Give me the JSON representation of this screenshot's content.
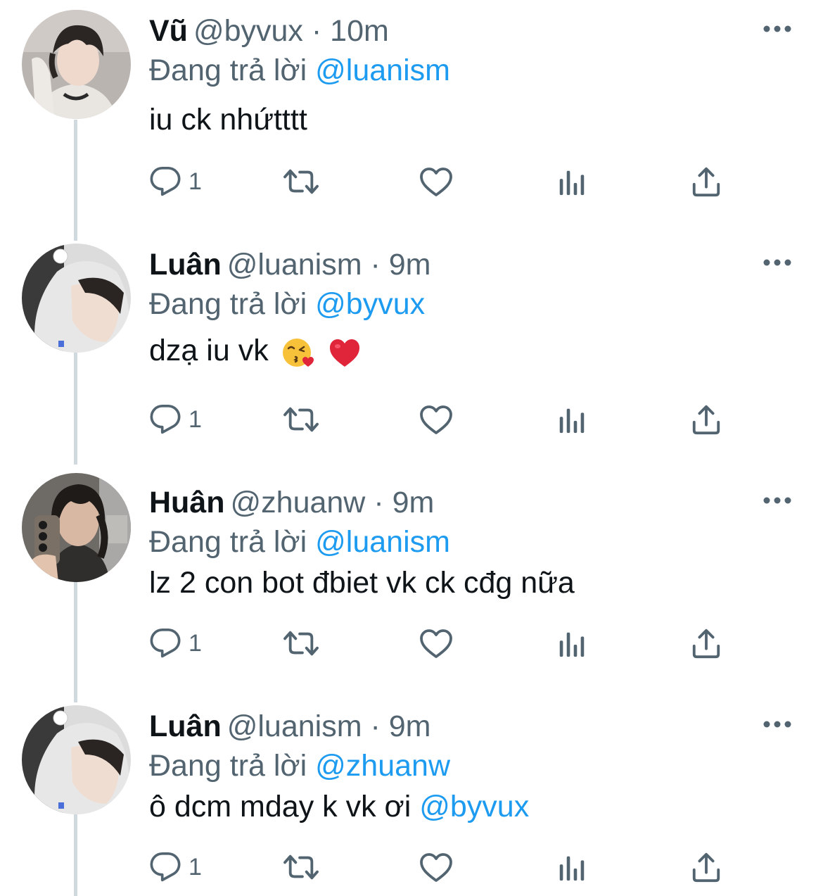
{
  "tweets": [
    {
      "name": "Vũ",
      "handle": "@byvux",
      "time": "10m",
      "reply_prefix": "Đang trả lời",
      "reply_to": "@luanism",
      "text": "iu ck nhứtttt",
      "text_mention": "",
      "emojis": [],
      "reply_count": "1",
      "avatar": "avatar-vu"
    },
    {
      "name": "Luân",
      "handle": "@luanism",
      "time": "9m",
      "reply_prefix": "Đang trả lời",
      "reply_to": "@byvux",
      "text": "dzạ iu vk",
      "text_mention": "",
      "emojis": [
        "kissing-face-with-heart",
        "red-heart"
      ],
      "reply_count": "1",
      "avatar": "avatar-luan"
    },
    {
      "name": "Huân",
      "handle": "@zhuanw",
      "time": "9m",
      "reply_prefix": "Đang trả lời",
      "reply_to": "@luanism",
      "text": "lz 2 con bot đbiet vk ck cđg nữa",
      "text_mention": "",
      "emojis": [],
      "reply_count": "1",
      "avatar": "avatar-huan"
    },
    {
      "name": "Luân",
      "handle": "@luanism",
      "time": "9m",
      "reply_prefix": "Đang trả lời",
      "reply_to": "@zhuanw",
      "text": "ô dcm mday k vk ơi ",
      "text_mention": "@byvux",
      "emojis": [],
      "reply_count": "1",
      "avatar": "avatar-luan"
    }
  ],
  "colors": {
    "text": "#0f1419",
    "secondary": "#536471",
    "mention": "#1d9bf0",
    "thread_line": "#cfd9de",
    "heart": "#e0243a"
  },
  "icons": [
    "reply-icon",
    "retweet-icon",
    "like-icon",
    "views-icon",
    "share-icon",
    "more-icon"
  ]
}
